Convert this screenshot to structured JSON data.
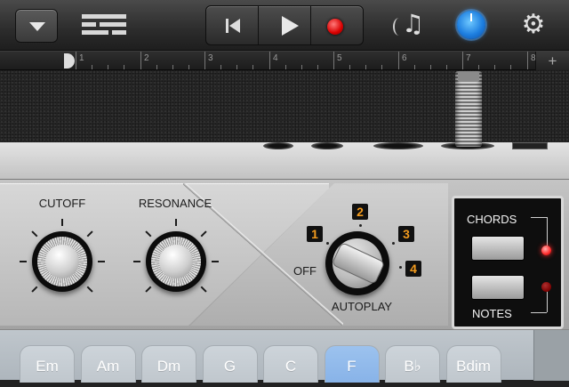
{
  "toolbar": {
    "menu_icon": "chevron-down-icon",
    "tracks_icon": "tracks-view-icon",
    "transport": [
      {
        "name": "go-to-beginning",
        "icon": "rewind-icon"
      },
      {
        "name": "play",
        "icon": "play-icon"
      },
      {
        "name": "record",
        "icon": "record-icon",
        "color": "#d90000"
      }
    ],
    "loops_icon": "notes-icon",
    "controls_icon": "controls-knob-icon",
    "controls_active_color": "#1e7fe0",
    "settings_icon": "gear-icon",
    "settings_glyph": "⚙"
  },
  "ruler": {
    "bars": [
      "1",
      "2",
      "3",
      "4",
      "5",
      "6",
      "7",
      "8"
    ],
    "add_label": "+"
  },
  "amp": {
    "cutoff_label": "CUTOFF",
    "resonance_label": "RESONANCE",
    "autoplay_label": "AUTOPLAY",
    "autoplay_off": "OFF",
    "autoplay_positions": [
      "1",
      "2",
      "3",
      "4"
    ],
    "autoplay_value": "OFF",
    "chords_label": "CHORDS",
    "notes_label": "NOTES",
    "led_on_color": "#ff2a2a",
    "led_off_color": "#7a0000",
    "selected_mode": "CHORDS"
  },
  "chords": {
    "items": [
      "Em",
      "Am",
      "Dm",
      "G",
      "C",
      "F",
      "B♭",
      "Bdim"
    ],
    "selected": "F",
    "selected_color": "#88b3e8"
  }
}
